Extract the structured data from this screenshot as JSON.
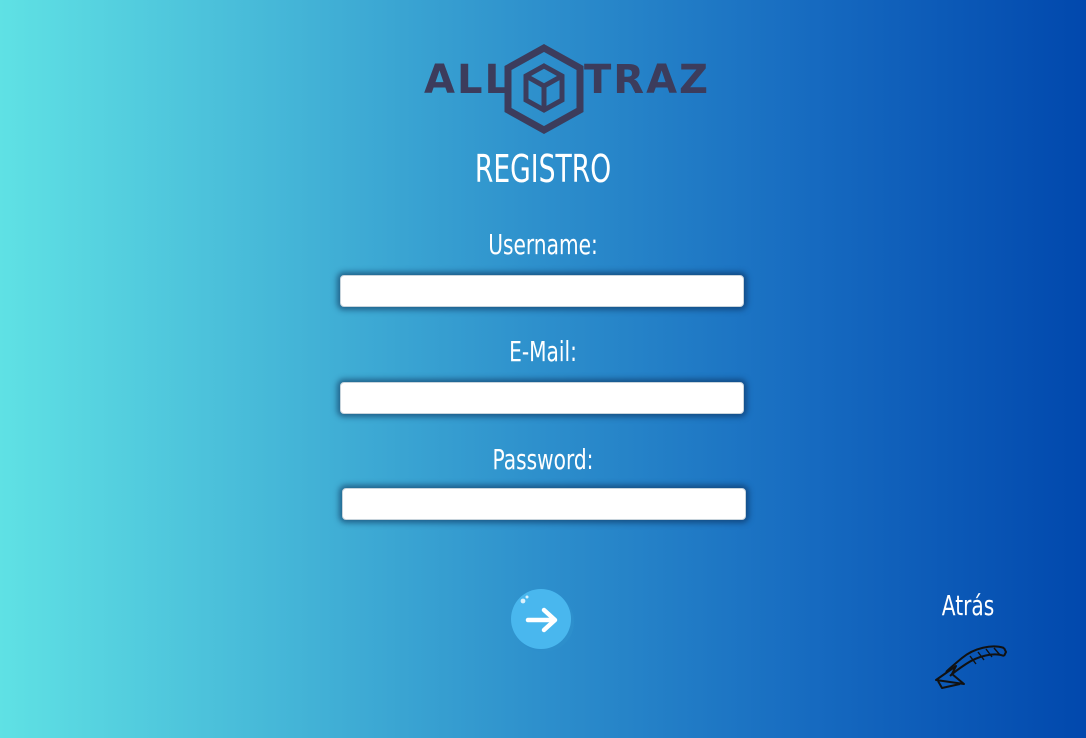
{
  "logo": {
    "left_text": "ALL",
    "right_text": "TRAZ",
    "icon": "hexagon-box-icon",
    "color": "#3c3c5c"
  },
  "page": {
    "title": "REGISTRO"
  },
  "form": {
    "username_label": "Username:",
    "username_value": "",
    "email_label": "E-Mail:",
    "email_value": "",
    "password_label": "Password:",
    "password_value": ""
  },
  "actions": {
    "submit_icon": "arrow-right-icon",
    "back_label": "Atrás",
    "back_icon": "curved-back-arrow-icon"
  },
  "colors": {
    "gradient_start": "#5fe1e4",
    "gradient_end": "#0148ad",
    "submit_button": "#49b7ee"
  }
}
